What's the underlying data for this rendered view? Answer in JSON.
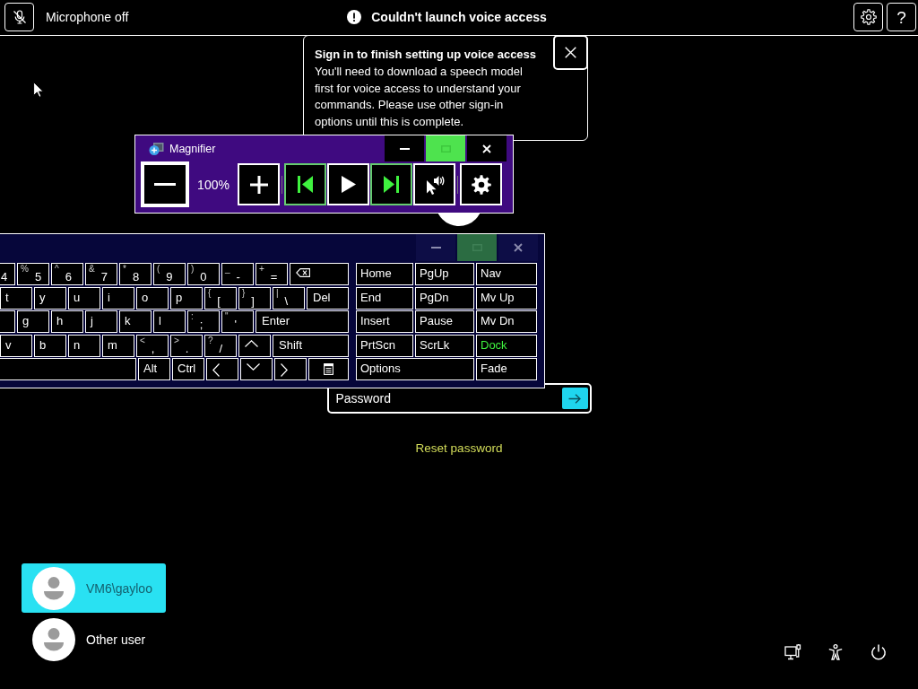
{
  "top_bar": {
    "microphone": {
      "muted": true,
      "label": "Microphone off"
    },
    "alert": {
      "text": "Couldn't launch voice access"
    },
    "buttons": [
      {
        "kind": "settings"
      },
      {
        "kind": "help",
        "text": "?"
      }
    ]
  },
  "toast": {
    "title": "Sign in to finish setting up voice access",
    "body": "You'll need to download a speech model first for voice access to understand your commands. Please use other sign-in options until this is complete."
  },
  "magnifier": {
    "title": "Magnifier",
    "focused": true,
    "window_controls": [
      {
        "kind": "minimize",
        "disabled": false
      },
      {
        "kind": "maximize",
        "disabled": true
      },
      {
        "kind": "close",
        "disabled": false
      }
    ],
    "toolbar": [
      {
        "kind": "zoom_out",
        "focused": true,
        "disabled": false
      },
      {
        "kind": "zoom_level",
        "text": "100%"
      },
      {
        "kind": "zoom_in",
        "focused": false,
        "disabled": false
      },
      {
        "kind": "previous",
        "focused": false,
        "disabled": true
      },
      {
        "kind": "play",
        "focused": false,
        "disabled": false
      },
      {
        "kind": "next",
        "focused": false,
        "disabled": true
      },
      {
        "kind": "read_from_pointer",
        "focused": false,
        "disabled": false
      },
      {
        "kind": "settings",
        "focused": false,
        "disabled": false
      }
    ]
  },
  "keyboard": {
    "focused": false,
    "window_controls": [
      {
        "kind": "minimize",
        "disabled": false
      },
      {
        "kind": "maximize",
        "disabled": true
      },
      {
        "kind": "close",
        "disabled": false
      }
    ],
    "rows": [
      {
        "keys": [
          {
            "kind": "cut",
            "label": "4"
          },
          {
            "kind": "char",
            "shift": "%",
            "label": "5"
          },
          {
            "kind": "char",
            "shift": "^",
            "label": "6"
          },
          {
            "kind": "char",
            "shift": "&",
            "label": "7"
          },
          {
            "kind": "char",
            "shift": "*",
            "label": "8"
          },
          {
            "kind": "char",
            "shift": "(",
            "label": "9"
          },
          {
            "kind": "char",
            "shift": ")",
            "label": "0"
          },
          {
            "kind": "char",
            "shift": "_",
            "label": "-"
          },
          {
            "kind": "char",
            "shift": "+",
            "label": "="
          },
          {
            "kind": "backspace"
          }
        ]
      },
      {
        "keys": [
          {
            "kind": "char",
            "label": "t"
          },
          {
            "kind": "char",
            "label": "y"
          },
          {
            "kind": "char",
            "label": "u"
          },
          {
            "kind": "char",
            "label": "i"
          },
          {
            "kind": "char",
            "label": "o"
          },
          {
            "kind": "char",
            "label": "p"
          },
          {
            "kind": "char",
            "shift": "{",
            "label": "["
          },
          {
            "kind": "char",
            "shift": "}",
            "label": "]"
          },
          {
            "kind": "char",
            "shift": "|",
            "label": "\\"
          },
          {
            "kind": "wide",
            "label": "Del"
          }
        ]
      },
      {
        "keys": [
          {
            "kind": "cut"
          },
          {
            "kind": "char",
            "label": "g"
          },
          {
            "kind": "char",
            "label": "h"
          },
          {
            "kind": "char",
            "label": "j"
          },
          {
            "kind": "char",
            "label": "k"
          },
          {
            "kind": "char",
            "label": "l"
          },
          {
            "kind": "char",
            "shift": ":",
            "label": ";"
          },
          {
            "kind": "char",
            "shift": "\"",
            "label": "'"
          },
          {
            "kind": "wide",
            "label": "Enter"
          }
        ]
      },
      {
        "keys": [
          {
            "kind": "char",
            "label": "v"
          },
          {
            "kind": "char",
            "label": "b"
          },
          {
            "kind": "char",
            "label": "n"
          },
          {
            "kind": "char",
            "label": "m"
          },
          {
            "kind": "char",
            "shift": "<",
            "label": ","
          },
          {
            "kind": "char",
            "shift": ">",
            "label": "."
          },
          {
            "kind": "char",
            "shift": "?",
            "label": "/"
          },
          {
            "kind": "arrow_up"
          },
          {
            "kind": "wide",
            "label": "Shift"
          }
        ]
      },
      {
        "keys": [
          {
            "kind": "space"
          },
          {
            "kind": "char",
            "label": "Alt"
          },
          {
            "kind": "char",
            "label": "Ctrl"
          },
          {
            "kind": "arrow_left"
          },
          {
            "kind": "arrow_down"
          },
          {
            "kind": "arrow_right"
          },
          {
            "kind": "menu"
          }
        ]
      }
    ],
    "nav_keys": [
      {
        "kind": "key",
        "label": "Home",
        "disabled": false
      },
      {
        "kind": "key",
        "label": "PgUp",
        "disabled": false
      },
      {
        "kind": "key",
        "label": "Nav",
        "disabled": false
      },
      {
        "kind": "key",
        "label": "End",
        "disabled": false
      },
      {
        "kind": "key",
        "label": "PgDn",
        "disabled": false
      },
      {
        "kind": "key",
        "label": "Mv Up",
        "disabled": false
      },
      {
        "kind": "key",
        "label": "Insert",
        "disabled": false
      },
      {
        "kind": "key",
        "label": "Pause",
        "disabled": false
      },
      {
        "kind": "key",
        "label": "Mv Dn",
        "disabled": false
      },
      {
        "kind": "key",
        "label": "PrtScn",
        "disabled": false
      },
      {
        "kind": "key",
        "label": "ScrLk",
        "disabled": false
      },
      {
        "kind": "key",
        "label": "Dock",
        "disabled": true
      },
      {
        "kind": "wide",
        "label": "Options",
        "disabled": false
      },
      {
        "kind": "key",
        "label": "Fade",
        "disabled": false
      }
    ]
  },
  "sign_in": {
    "password": {
      "placeholder": "Password"
    },
    "reset_link": "Reset password"
  },
  "users": [
    {
      "name": "VM6\\gayloo",
      "selected": true
    },
    {
      "name": "Other user",
      "selected": false
    }
  ],
  "system_buttons": [
    {
      "kind": "network"
    },
    {
      "kind": "accessibility"
    },
    {
      "kind": "power"
    }
  ]
}
